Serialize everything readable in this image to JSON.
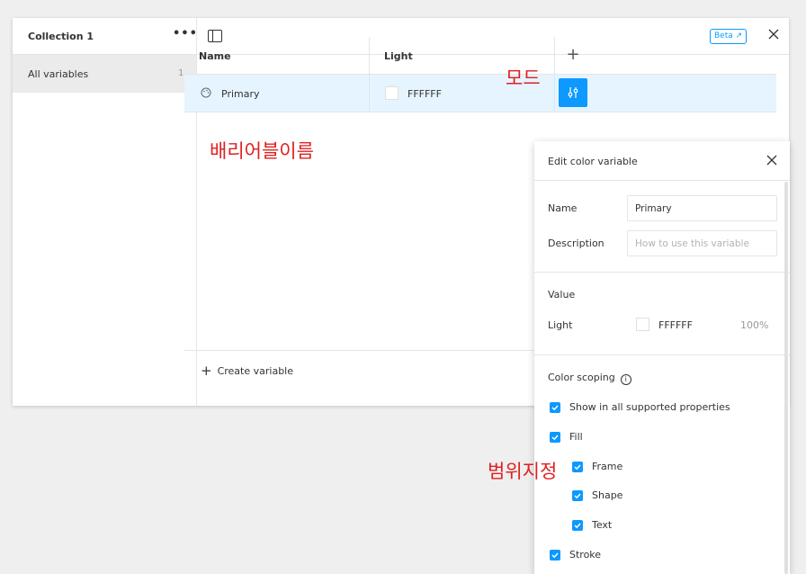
{
  "sidebar": {
    "collection_title": "Collection 1",
    "more_icon": "•••",
    "items": [
      {
        "label": "All variables",
        "count": "1"
      }
    ]
  },
  "topbar": {
    "beta_label": "Beta ↗",
    "close_icon": "close-icon"
  },
  "table": {
    "columns": [
      {
        "label": "Name"
      },
      {
        "label": "Light"
      }
    ],
    "add_mode_label": "+",
    "rows": [
      {
        "name": "Primary",
        "value": "FFFFFF",
        "swatch_color": "#FFFFFF"
      }
    ]
  },
  "footer": {
    "create_label": "Create variable",
    "plus": "+"
  },
  "annotations": {
    "mode": "모드",
    "variable_name": "배리어블이름",
    "scoping": "범위지정"
  },
  "popover": {
    "title": "Edit color variable",
    "name_label": "Name",
    "name_value": "Primary",
    "description_label": "Description",
    "description_placeholder": "How to use this variable",
    "value_section": "Value",
    "mode_label": "Light",
    "mode_hex": "FFFFFF",
    "mode_opacity": "100%",
    "scoping_section": "Color scoping",
    "scopes": [
      {
        "label": "Show in all supported properties",
        "checked": true
      },
      {
        "label": "Fill",
        "checked": true
      },
      {
        "label": "Frame",
        "checked": true
      },
      {
        "label": "Shape",
        "checked": true
      },
      {
        "label": "Text",
        "checked": true
      },
      {
        "label": "Stroke",
        "checked": true
      }
    ]
  },
  "colors": {
    "accent": "#0d99ff",
    "row_highlight": "#e5f4ff",
    "annotation": "#e02020"
  }
}
